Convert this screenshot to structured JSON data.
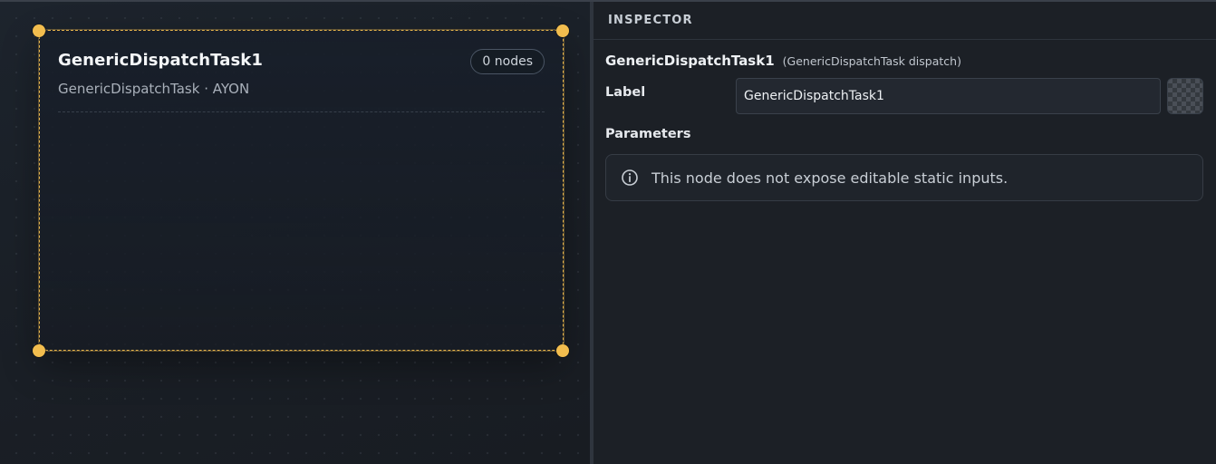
{
  "canvas": {
    "group": {
      "title": "GenericDispatchTask1",
      "subtitle": "GenericDispatchTask · AYON",
      "node_count": "0 nodes"
    }
  },
  "inspector": {
    "title": "INSPECTOR",
    "node_name": "GenericDispatchTask1",
    "node_type": "(GenericDispatchTask dispatch)",
    "label_field": {
      "label": "Label",
      "value": "GenericDispatchTask1"
    },
    "parameters": {
      "title": "Parameters",
      "info_icon": "info-circle-icon",
      "message": "This node does not expose editable static inputs."
    }
  },
  "colors": {
    "accent": "#f2bd4e",
    "canvas_bg": "#1a1f26",
    "panel_bg": "#1c2026"
  }
}
